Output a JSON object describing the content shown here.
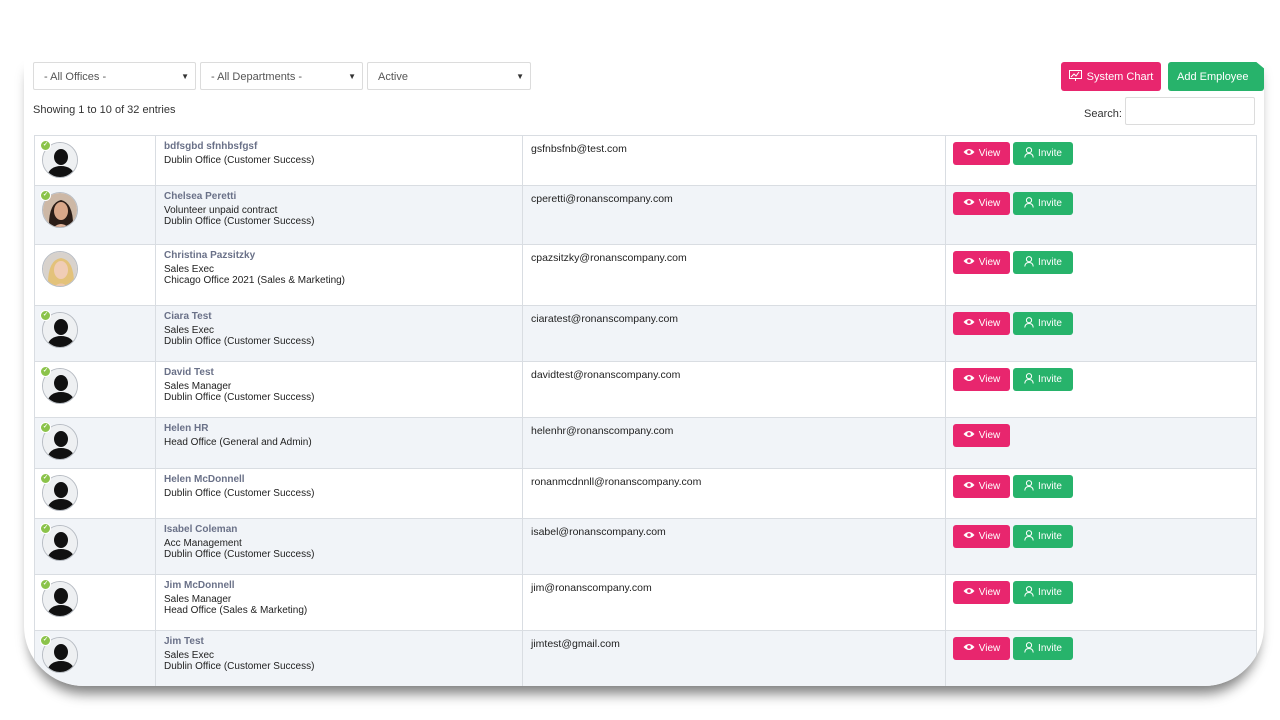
{
  "filters": {
    "offices": "- All Offices -",
    "departments": "- All Departments -",
    "status": "Active"
  },
  "toolbar": {
    "system_chart": "System Chart",
    "add_employee": "Add Employee"
  },
  "table_info": "Showing 1 to 10 of 32 entries",
  "search_label": "Search:",
  "buttons": {
    "view": "View",
    "invite": "Invite"
  },
  "rows": [
    {
      "name": "bdfsgbd sfnhbsfgsf",
      "role": "",
      "office": "Dublin Office (Customer Success)",
      "email": "gsfnbsfnb@test.com",
      "photo": "silhouette",
      "badge": true,
      "invite": true
    },
    {
      "name": "Chelsea Peretti",
      "role": "Volunteer unpaid contract",
      "office": "Dublin Office (Customer Success)",
      "email": "cperetti@ronanscompany.com",
      "photo": "photo-dark",
      "badge": true,
      "invite": true
    },
    {
      "name": "Christina Pazsitzky",
      "role": "Sales Exec",
      "office": "Chicago Office 2021 (Sales & Marketing)",
      "email": "cpazsitzky@ronanscompany.com",
      "photo": "photo-blonde",
      "badge": false,
      "invite": true
    },
    {
      "name": "Ciara Test",
      "role": "Sales Exec",
      "office": "Dublin Office (Customer Success)",
      "email": "ciaratest@ronanscompany.com",
      "photo": "silhouette",
      "badge": true,
      "invite": true
    },
    {
      "name": "David Test",
      "role": "Sales Manager",
      "office": "Dublin Office (Customer Success)",
      "email": "davidtest@ronanscompany.com",
      "photo": "silhouette",
      "badge": true,
      "invite": true
    },
    {
      "name": "Helen HR",
      "role": "",
      "office": "Head Office (General and Admin)",
      "email": "helenhr@ronanscompany.com",
      "photo": "silhouette",
      "badge": true,
      "invite": false
    },
    {
      "name": "Helen McDonnell",
      "role": "",
      "office": "Dublin Office (Customer Success)",
      "email": "ronanmcdnnll@ronanscompany.com",
      "photo": "silhouette",
      "badge": true,
      "invite": true
    },
    {
      "name": "Isabel Coleman",
      "role": "Acc Management",
      "office": "Dublin Office (Customer Success)",
      "email": "isabel@ronanscompany.com",
      "photo": "silhouette",
      "badge": true,
      "invite": true
    },
    {
      "name": "Jim McDonnell",
      "role": "Sales Manager",
      "office": "Head Office (Sales & Marketing)",
      "email": "jim@ronanscompany.com",
      "photo": "silhouette",
      "badge": true,
      "invite": true
    },
    {
      "name": "Jim Test",
      "role": "Sales Exec",
      "office": "Dublin Office (Customer Success)",
      "email": "jimtest@gmail.com",
      "photo": "silhouette",
      "badge": true,
      "invite": true
    }
  ]
}
